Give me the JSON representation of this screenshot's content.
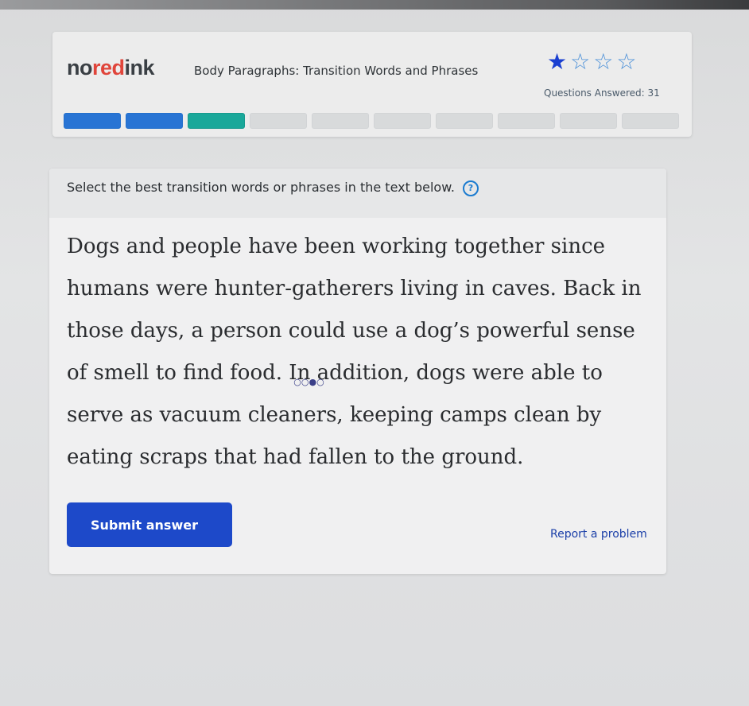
{
  "app": {
    "logo": {
      "part1": "no",
      "part2": "red",
      "part3": "ink"
    },
    "lesson_title": "Body Paragraphs: Transition Words and Phrases",
    "rating": {
      "filled": 1,
      "total": 4
    },
    "questions_answered": "Questions Answered: 31",
    "progress": {
      "completed": 3,
      "total": 10
    }
  },
  "question": {
    "prompt": "Select the best transition words or phrases in the text below.",
    "help_icon": "?",
    "passage": {
      "before": "Dogs and people have been working together since humans were hunter-gatherers living in caves. Back in those days, a person could use a dog’s powerful sense of smell to find food.",
      "selected": "In addition,",
      "after": "dogs were able to serve as vacuum cleaners, keeping camps clean by eating scraps that had fallen to the ground."
    },
    "choice_indicator": "○○●○"
  },
  "actions": {
    "submit_label": "Submit answer",
    "report_label": "Report a problem"
  },
  "colors": {
    "accent_blue": "#1d49c9",
    "progress_blue": "#2874d4",
    "progress_teal": "#1aa89a",
    "logo_red": "#e0453b"
  }
}
